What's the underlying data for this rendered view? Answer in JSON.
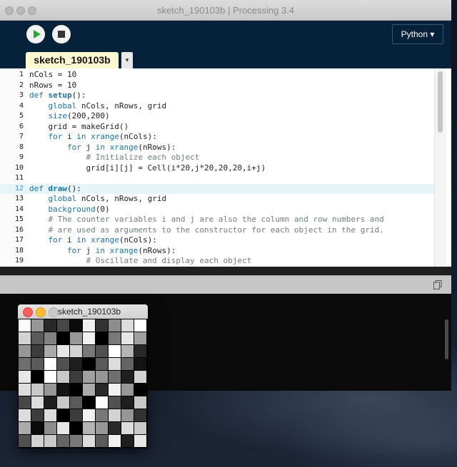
{
  "window": {
    "title": "sketch_190103b | Processing 3.4"
  },
  "toolbar": {
    "mode_label": "Python ▾"
  },
  "tabs": {
    "active_label": "sketch_190103b",
    "menu_glyph": "▾"
  },
  "editor": {
    "current_line": 12,
    "lines": [
      {
        "n": "1",
        "segs": [
          {
            "t": "nCols = 10",
            "c": ""
          }
        ]
      },
      {
        "n": "2",
        "segs": [
          {
            "t": "nRows = 10",
            "c": ""
          }
        ]
      },
      {
        "n": "3",
        "segs": [
          {
            "t": "def ",
            "c": "kw"
          },
          {
            "t": "setup",
            "c": "fn"
          },
          {
            "t": "():",
            "c": ""
          }
        ]
      },
      {
        "n": "4",
        "segs": [
          {
            "t": "    ",
            "c": ""
          },
          {
            "t": "global",
            "c": "kw"
          },
          {
            "t": " nCols, nRows, grid",
            "c": ""
          }
        ]
      },
      {
        "n": "5",
        "segs": [
          {
            "t": "    ",
            "c": ""
          },
          {
            "t": "size",
            "c": "kw"
          },
          {
            "t": "(200,200)",
            "c": ""
          }
        ]
      },
      {
        "n": "6",
        "segs": [
          {
            "t": "    grid = makeGrid()",
            "c": ""
          }
        ]
      },
      {
        "n": "7",
        "segs": [
          {
            "t": "    ",
            "c": ""
          },
          {
            "t": "for",
            "c": "kw"
          },
          {
            "t": " i ",
            "c": ""
          },
          {
            "t": "in",
            "c": "kw"
          },
          {
            "t": " ",
            "c": ""
          },
          {
            "t": "xrange",
            "c": "kw"
          },
          {
            "t": "(nCols):",
            "c": ""
          }
        ]
      },
      {
        "n": "8",
        "segs": [
          {
            "t": "        ",
            "c": ""
          },
          {
            "t": "for",
            "c": "kw"
          },
          {
            "t": " j ",
            "c": ""
          },
          {
            "t": "in",
            "c": "kw"
          },
          {
            "t": " ",
            "c": ""
          },
          {
            "t": "xrange",
            "c": "kw"
          },
          {
            "t": "(nRows):",
            "c": ""
          }
        ]
      },
      {
        "n": "9",
        "segs": [
          {
            "t": "            # Initialize each object",
            "c": "cm"
          }
        ]
      },
      {
        "n": "10",
        "segs": [
          {
            "t": "            grid[i][j] = Cell(i*20,j*20,20,20,i+j)",
            "c": ""
          }
        ]
      },
      {
        "n": "11",
        "segs": [
          {
            "t": "",
            "c": ""
          }
        ]
      },
      {
        "n": "12",
        "segs": [
          {
            "t": "def ",
            "c": "kw"
          },
          {
            "t": "draw",
            "c": "fn"
          },
          {
            "t": "():",
            "c": ""
          }
        ]
      },
      {
        "n": "13",
        "segs": [
          {
            "t": "    ",
            "c": ""
          },
          {
            "t": "global",
            "c": "kw"
          },
          {
            "t": " nCols, nRows, grid",
            "c": ""
          }
        ]
      },
      {
        "n": "14",
        "segs": [
          {
            "t": "    ",
            "c": ""
          },
          {
            "t": "background",
            "c": "kw"
          },
          {
            "t": "(0)",
            "c": ""
          }
        ]
      },
      {
        "n": "15",
        "segs": [
          {
            "t": "    # The counter variables i and j are also the column and row numbers and",
            "c": "cm"
          }
        ]
      },
      {
        "n": "16",
        "segs": [
          {
            "t": "    # are used as arguments to the constructor for each object in the grid.",
            "c": "cm"
          }
        ]
      },
      {
        "n": "17",
        "segs": [
          {
            "t": "    ",
            "c": ""
          },
          {
            "t": "for",
            "c": "kw"
          },
          {
            "t": " i ",
            "c": ""
          },
          {
            "t": "in",
            "c": "kw"
          },
          {
            "t": " ",
            "c": ""
          },
          {
            "t": "xrange",
            "c": "kw"
          },
          {
            "t": "(nCols):",
            "c": ""
          }
        ]
      },
      {
        "n": "18",
        "segs": [
          {
            "t": "        ",
            "c": ""
          },
          {
            "t": "for",
            "c": "kw"
          },
          {
            "t": " j ",
            "c": ""
          },
          {
            "t": "in",
            "c": "kw"
          },
          {
            "t": " ",
            "c": ""
          },
          {
            "t": "xrange",
            "c": "kw"
          },
          {
            "t": "(nRows):",
            "c": ""
          }
        ]
      },
      {
        "n": "19",
        "segs": [
          {
            "t": "            # Oscillate and display each object",
            "c": "cm"
          }
        ]
      }
    ]
  },
  "sketch_window": {
    "title": "sketch_190103b",
    "grid": [
      [
        250,
        150,
        40,
        70,
        10,
        240,
        50,
        140,
        220,
        255
      ],
      [
        210,
        90,
        130,
        0,
        150,
        240,
        0,
        120,
        230,
        160
      ],
      [
        150,
        60,
        170,
        230,
        210,
        120,
        80,
        255,
        180,
        40
      ],
      [
        110,
        90,
        255,
        80,
        30,
        0,
        90,
        220,
        100,
        20
      ],
      [
        230,
        0,
        255,
        200,
        60,
        160,
        150,
        110,
        30,
        210
      ],
      [
        220,
        200,
        150,
        20,
        0,
        170,
        40,
        240,
        150,
        0
      ],
      [
        70,
        220,
        30,
        200,
        90,
        0,
        255,
        80,
        30,
        200
      ],
      [
        220,
        60,
        220,
        0,
        60,
        240,
        120,
        210,
        150,
        50
      ],
      [
        170,
        10,
        140,
        230,
        0,
        180,
        150,
        40,
        220,
        200
      ],
      [
        80,
        210,
        200,
        100,
        120,
        220,
        90,
        240,
        30,
        230
      ]
    ]
  },
  "colors": {
    "toolbar_bg": "#06213a",
    "tab_active_bg": "#fbf8d2",
    "play_green": "#2da834",
    "keyword_blue": "#1872a8",
    "comment_gray": "#6f7c84"
  }
}
